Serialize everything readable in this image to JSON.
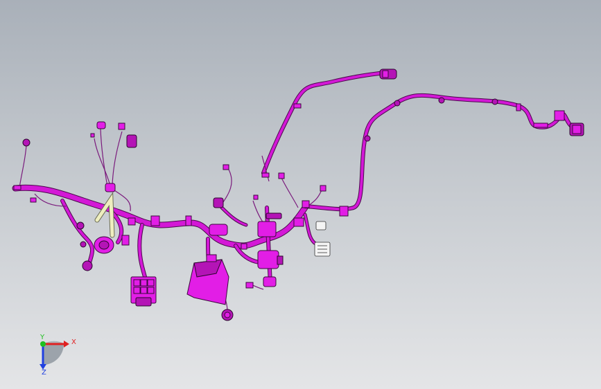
{
  "viewport": {
    "background_top": "#a9b0b9",
    "background_bottom": "#e4e5e7",
    "harness_color": "#d318d6",
    "secondary_color": "#eeeebf"
  },
  "triad": {
    "x_label": "X",
    "y_label": "Y",
    "z_label": "Z",
    "x_color": "#e02020",
    "y_color": "#20c020",
    "z_color": "#2040e0"
  }
}
